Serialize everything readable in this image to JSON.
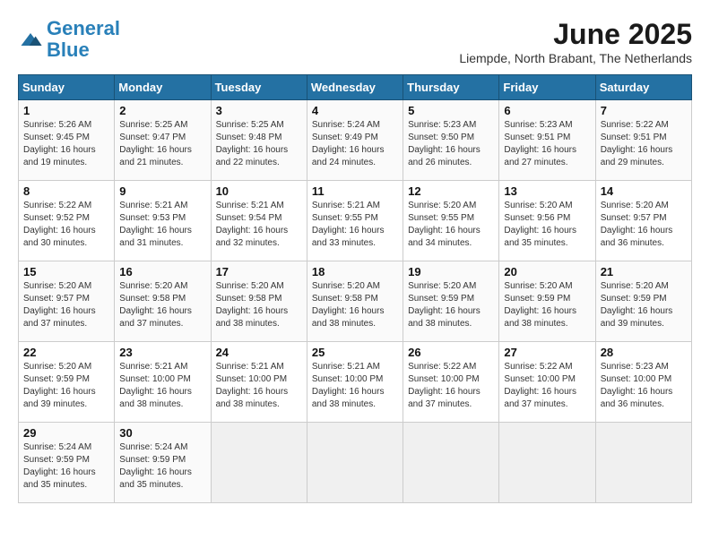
{
  "header": {
    "logo_line1": "General",
    "logo_line2": "Blue",
    "month": "June 2025",
    "location": "Liempde, North Brabant, The Netherlands"
  },
  "columns": [
    "Sunday",
    "Monday",
    "Tuesday",
    "Wednesday",
    "Thursday",
    "Friday",
    "Saturday"
  ],
  "weeks": [
    [
      {
        "day": "1",
        "info": "Sunrise: 5:26 AM\nSunset: 9:45 PM\nDaylight: 16 hours\nand 19 minutes."
      },
      {
        "day": "2",
        "info": "Sunrise: 5:25 AM\nSunset: 9:47 PM\nDaylight: 16 hours\nand 21 minutes."
      },
      {
        "day": "3",
        "info": "Sunrise: 5:25 AM\nSunset: 9:48 PM\nDaylight: 16 hours\nand 22 minutes."
      },
      {
        "day": "4",
        "info": "Sunrise: 5:24 AM\nSunset: 9:49 PM\nDaylight: 16 hours\nand 24 minutes."
      },
      {
        "day": "5",
        "info": "Sunrise: 5:23 AM\nSunset: 9:50 PM\nDaylight: 16 hours\nand 26 minutes."
      },
      {
        "day": "6",
        "info": "Sunrise: 5:23 AM\nSunset: 9:51 PM\nDaylight: 16 hours\nand 27 minutes."
      },
      {
        "day": "7",
        "info": "Sunrise: 5:22 AM\nSunset: 9:51 PM\nDaylight: 16 hours\nand 29 minutes."
      }
    ],
    [
      {
        "day": "8",
        "info": "Sunrise: 5:22 AM\nSunset: 9:52 PM\nDaylight: 16 hours\nand 30 minutes."
      },
      {
        "day": "9",
        "info": "Sunrise: 5:21 AM\nSunset: 9:53 PM\nDaylight: 16 hours\nand 31 minutes."
      },
      {
        "day": "10",
        "info": "Sunrise: 5:21 AM\nSunset: 9:54 PM\nDaylight: 16 hours\nand 32 minutes."
      },
      {
        "day": "11",
        "info": "Sunrise: 5:21 AM\nSunset: 9:55 PM\nDaylight: 16 hours\nand 33 minutes."
      },
      {
        "day": "12",
        "info": "Sunrise: 5:20 AM\nSunset: 9:55 PM\nDaylight: 16 hours\nand 34 minutes."
      },
      {
        "day": "13",
        "info": "Sunrise: 5:20 AM\nSunset: 9:56 PM\nDaylight: 16 hours\nand 35 minutes."
      },
      {
        "day": "14",
        "info": "Sunrise: 5:20 AM\nSunset: 9:57 PM\nDaylight: 16 hours\nand 36 minutes."
      }
    ],
    [
      {
        "day": "15",
        "info": "Sunrise: 5:20 AM\nSunset: 9:57 PM\nDaylight: 16 hours\nand 37 minutes."
      },
      {
        "day": "16",
        "info": "Sunrise: 5:20 AM\nSunset: 9:58 PM\nDaylight: 16 hours\nand 37 minutes."
      },
      {
        "day": "17",
        "info": "Sunrise: 5:20 AM\nSunset: 9:58 PM\nDaylight: 16 hours\nand 38 minutes."
      },
      {
        "day": "18",
        "info": "Sunrise: 5:20 AM\nSunset: 9:58 PM\nDaylight: 16 hours\nand 38 minutes."
      },
      {
        "day": "19",
        "info": "Sunrise: 5:20 AM\nSunset: 9:59 PM\nDaylight: 16 hours\nand 38 minutes."
      },
      {
        "day": "20",
        "info": "Sunrise: 5:20 AM\nSunset: 9:59 PM\nDaylight: 16 hours\nand 38 minutes."
      },
      {
        "day": "21",
        "info": "Sunrise: 5:20 AM\nSunset: 9:59 PM\nDaylight: 16 hours\nand 39 minutes."
      }
    ],
    [
      {
        "day": "22",
        "info": "Sunrise: 5:20 AM\nSunset: 9:59 PM\nDaylight: 16 hours\nand 39 minutes."
      },
      {
        "day": "23",
        "info": "Sunrise: 5:21 AM\nSunset: 10:00 PM\nDaylight: 16 hours\nand 38 minutes."
      },
      {
        "day": "24",
        "info": "Sunrise: 5:21 AM\nSunset: 10:00 PM\nDaylight: 16 hours\nand 38 minutes."
      },
      {
        "day": "25",
        "info": "Sunrise: 5:21 AM\nSunset: 10:00 PM\nDaylight: 16 hours\nand 38 minutes."
      },
      {
        "day": "26",
        "info": "Sunrise: 5:22 AM\nSunset: 10:00 PM\nDaylight: 16 hours\nand 37 minutes."
      },
      {
        "day": "27",
        "info": "Sunrise: 5:22 AM\nSunset: 10:00 PM\nDaylight: 16 hours\nand 37 minutes."
      },
      {
        "day": "28",
        "info": "Sunrise: 5:23 AM\nSunset: 10:00 PM\nDaylight: 16 hours\nand 36 minutes."
      }
    ],
    [
      {
        "day": "29",
        "info": "Sunrise: 5:24 AM\nSunset: 9:59 PM\nDaylight: 16 hours\nand 35 minutes."
      },
      {
        "day": "30",
        "info": "Sunrise: 5:24 AM\nSunset: 9:59 PM\nDaylight: 16 hours\nand 35 minutes."
      },
      {
        "day": "",
        "info": ""
      },
      {
        "day": "",
        "info": ""
      },
      {
        "day": "",
        "info": ""
      },
      {
        "day": "",
        "info": ""
      },
      {
        "day": "",
        "info": ""
      }
    ]
  ]
}
